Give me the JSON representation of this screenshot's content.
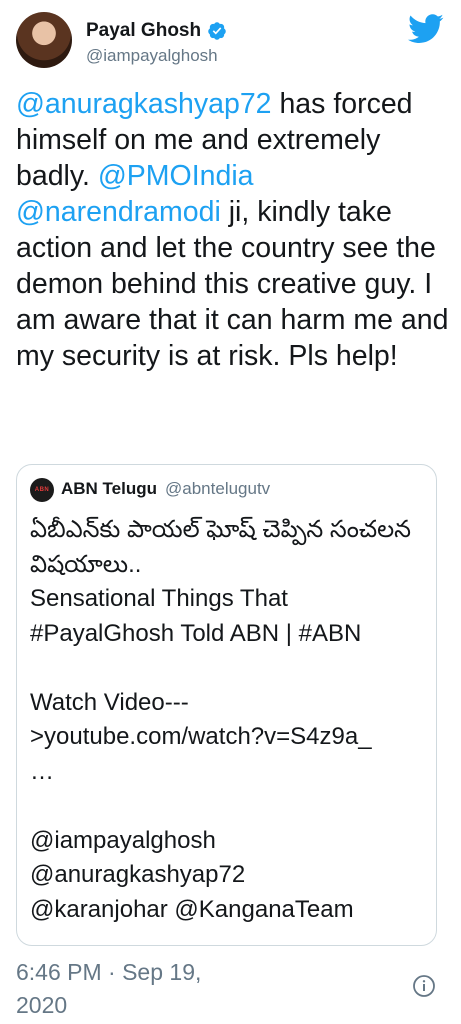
{
  "author": {
    "name": "Payal Ghosh",
    "handle": "@iampayalghosh",
    "verified_icon": "verified-badge-icon"
  },
  "brand": {
    "icon": "twitter-bird-icon",
    "color": "#1da1f2"
  },
  "tweet": {
    "mention_1": "@anuragkashyap72",
    "text_1": " has forced himself on me and extremely badly. ",
    "mention_2": "@PMOIndia",
    "space": " ",
    "mention_3": "@narendramodi",
    "text_2": " ji, kindly take action and let the country see the demon behind this creative guy. I am aware that it can harm me and my security is at risk. Pls help!"
  },
  "quoted_tweet": {
    "avatar_text": "ABN",
    "name": "ABN Telugu",
    "handle": "@abntelugutv",
    "text": "ఏబీఎన్‌కు పాయల్ ఘోష్ చెప్పిన సంచలన విషయాలు..\nSensational Things That #PayalGhosh Told ABN | #ABN\n\nWatch Video---\n>youtube.com/watch?v=S4z9a_\n…\n\n@iampayalghosh\n@anuragkashyap72\n@karanjohar @KanganaTeam"
  },
  "timestamp": "6:46 PM · Sep 19, 2020",
  "info_icon": "info-icon"
}
